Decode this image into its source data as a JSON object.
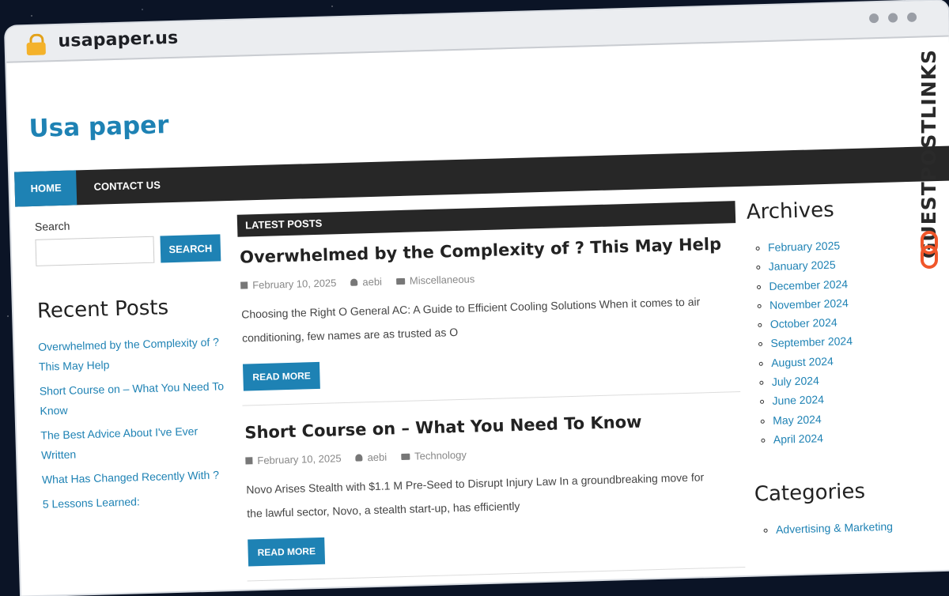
{
  "browser": {
    "url": "usapaper.us"
  },
  "site": {
    "title": "Usa paper"
  },
  "nav": {
    "items": [
      {
        "label": "HOME"
      },
      {
        "label": "CONTACT US"
      }
    ]
  },
  "left_sidebar": {
    "search_label": "Search",
    "search_button": "SEARCH",
    "recent_heading": "Recent Posts",
    "recent_posts": [
      "Overwhelmed by the Complexity of ? This May Help",
      "Short Course on – What You Need To Know",
      "The Best Advice About I've Ever Written",
      "What Has Changed Recently With ?",
      "5 Lessons Learned:"
    ]
  },
  "main": {
    "section_label": "LATEST POSTS",
    "posts": [
      {
        "title": "Overwhelmed by the Complexity of ? This May Help",
        "date": "February 10, 2025",
        "author": "aebi",
        "category": "Miscellaneous",
        "excerpt": "Choosing the Right O General AC: A Guide to Efficient Cooling Solutions When it comes to air conditioning, few names are as trusted as O",
        "read_more": "READ MORE"
      },
      {
        "title": "Short Course on – What You Need To Know",
        "date": "February 10, 2025",
        "author": "aebi",
        "category": "Technology",
        "excerpt": "Novo Arises Stealth with $1.1 M Pre-Seed to Disrupt Injury Law In a groundbreaking move for the lawful sector, Novo, a stealth start-up, has efficiently",
        "read_more": "READ MORE"
      }
    ]
  },
  "right_sidebar": {
    "archives_heading": "Archives",
    "archives": [
      "February 2025",
      "January 2025",
      "December 2024",
      "November 2024",
      "October 2024",
      "September 2024",
      "August 2024",
      "July 2024",
      "June 2024",
      "May 2024",
      "April 2024"
    ],
    "categories_heading": "Categories",
    "categories": [
      "Advertising & Marketing"
    ]
  },
  "watermark": {
    "text": "GUESTPOSTLINKS"
  },
  "colors": {
    "accent": "#1e82b4",
    "nav_bg": "#272727",
    "brand_logo": "#f0562a"
  }
}
